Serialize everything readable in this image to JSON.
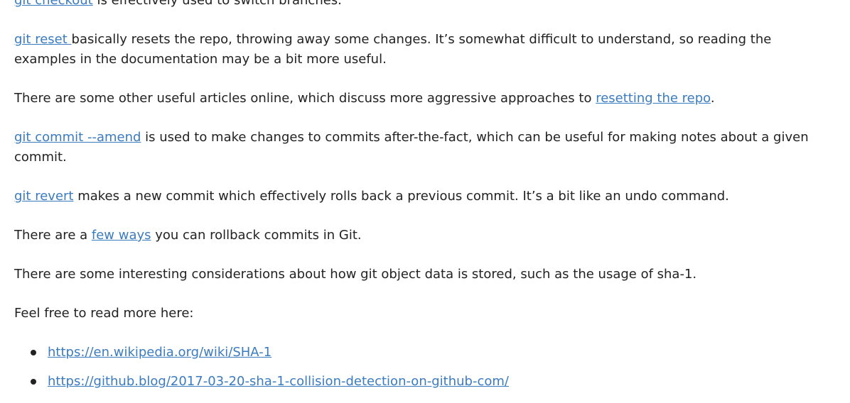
{
  "paragraphs": {
    "checkout": {
      "link": "git checkout",
      "text": " is effectively used to switch branches."
    },
    "reset": {
      "link": "git reset ",
      "text": "basically resets the repo, throwing away some changes. It’s somewhat difficult to understand, so reading the examples in the documentation may be a bit more useful."
    },
    "resetting": {
      "text_before": "There are some other useful articles online, which discuss more aggressive approaches to ",
      "link": "resetting the repo",
      "text_after": "."
    },
    "amend": {
      "link": "git commit --amend",
      "text": " is used to make changes to commits after-the-fact, which can be useful for making notes about a given commit."
    },
    "revert": {
      "link": "git revert",
      "text": " makes a new commit which effectively rolls back a previous commit. It’s a bit like an undo command."
    },
    "rollback": {
      "text_before": "There are a ",
      "link": "few ways",
      "text_after": " you can rollback commits in Git."
    },
    "sha1": {
      "text": "There are some interesting considerations about how git object data is stored, such as the usage of sha-1."
    },
    "read_more": {
      "text": "Feel free to read more here:"
    }
  },
  "links_list": [
    "https://en.wikipedia.org/wiki/SHA-1",
    "https://github.blog/2017-03-20-sha-1-collision-detection-on-github-com/"
  ]
}
